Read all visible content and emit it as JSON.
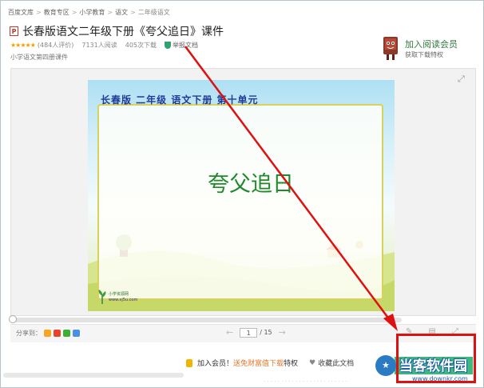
{
  "breadcrumb": {
    "items": [
      "百度文库",
      "教育专区",
      "小学教育",
      "语文"
    ],
    "current": "二年级语文",
    "separator": ">"
  },
  "document": {
    "type_icon": "P",
    "title": "长春版语文二年级下册《夸父追日》课件",
    "rating_count": "(484人评价)",
    "reads": "7131人阅读",
    "downloads": "405次下载",
    "report": "举报文档",
    "tag": "小学语文第四册课件",
    "rating_stars": 4.5
  },
  "vip_promo": {
    "title": "加入阅读会员",
    "subtitle": "获取下载特权"
  },
  "slide": {
    "heading": "长春版 二年级 语文下册 第十单元",
    "main_text": "夸父追日",
    "logo_name": "小学资源网",
    "logo_url": "www.xj5u.com"
  },
  "controls": {
    "share_label": "分享到：",
    "current_page": "1",
    "total_pages": "/ 15",
    "prev_icon": "←",
    "next_icon": "→",
    "scroll_progress": 0.01
  },
  "bottom_bar": {
    "join_text": "加入会员！",
    "join_link": "送免财富值下载",
    "join_suffix": "特权",
    "favorite": "收藏此文档"
  },
  "watermark": {
    "title": "当客软件园",
    "url": "www.downkr.com"
  },
  "colors": {
    "accent_green": "#3fb87d",
    "annotation_red": "#e01010",
    "star_orange": "#f3a100"
  }
}
